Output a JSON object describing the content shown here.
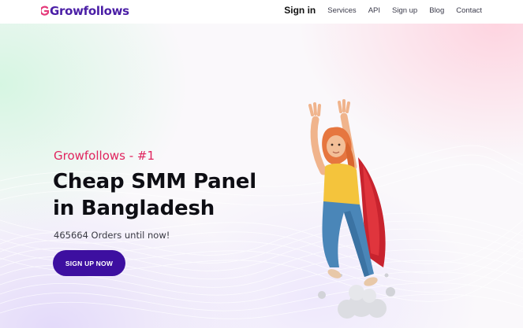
{
  "header": {
    "logo_text": "Growfollows",
    "nav": {
      "sign_in": "Sign in",
      "services": "Services",
      "api": "API",
      "sign_up": "Sign up",
      "blog": "Blog",
      "contact": "Contact"
    }
  },
  "hero": {
    "eyebrow": "Growfollows - #1",
    "headline": "Cheap SMM Panel in Bangladesh",
    "stats": "465664 Orders until now!",
    "cta_label": "SIGN UP NOW"
  },
  "colors": {
    "brand_purple": "#3d0fa0",
    "accent_pink": "#e0245e",
    "logo_purple": "#4b1fa6"
  },
  "icons": [
    "logo-mark-icon"
  ]
}
